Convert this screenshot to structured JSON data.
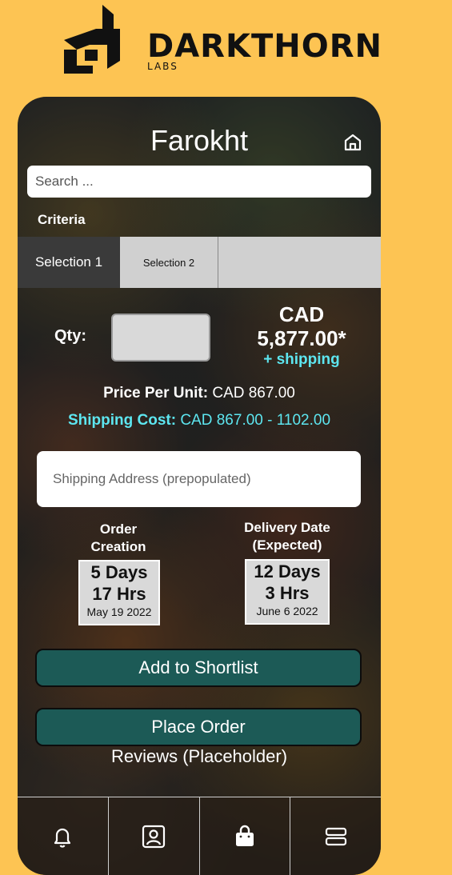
{
  "brand": {
    "name": "DARKTHORN",
    "sub": "LABS"
  },
  "header": {
    "title": "Farokht",
    "home_icon": "home-icon"
  },
  "search": {
    "placeholder": "Search ..."
  },
  "criteria_label": "Criteria",
  "tabs": [
    {
      "label": "Selection 1"
    },
    {
      "label": "Selection 2"
    },
    {
      "label": ""
    }
  ],
  "order": {
    "qty_label": "Qty:",
    "qty_value": "",
    "currency": "CAD",
    "total": "5,877.00*",
    "shipping_note": "+ shipping",
    "ppu_label": "Price Per Unit:",
    "ppu_value": "CAD 867.00",
    "shipcost_label": "Shipping Cost:",
    "shipcost_value": "CAD 867.00 - 1102.00",
    "address_placeholder": "Shipping Address (prepopulated)"
  },
  "order_creation": {
    "heading_line1": "Order",
    "heading_line2": "Creation",
    "days": "5 Days",
    "hours": "17 Hrs",
    "date": "May 19 2022"
  },
  "delivery": {
    "heading_line1": "Delivery Date",
    "heading_line2": "(Expected)",
    "days": "12 Days",
    "hours": "3 Hrs",
    "date": "June 6 2022"
  },
  "actions": {
    "shortlist": "Add to Shortlist",
    "place_order": "Place Order",
    "reviews": "Reviews (Placeholder)"
  },
  "colors": {
    "background": "#fdc453",
    "button": "#1c5a56",
    "accent": "#5de6f0"
  },
  "nav": [
    {
      "icon": "bell-icon"
    },
    {
      "icon": "contact-icon"
    },
    {
      "icon": "shopping-bag-icon"
    },
    {
      "icon": "menu-icon"
    }
  ]
}
